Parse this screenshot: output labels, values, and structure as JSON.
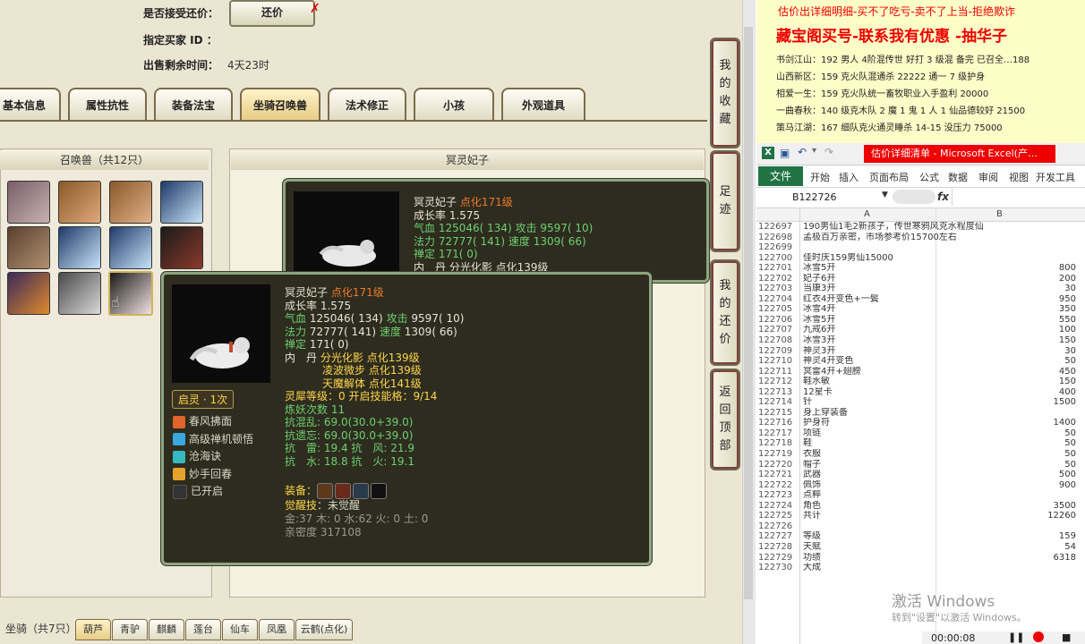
{
  "listing": {
    "accept_counter_label": "是否接受还价：",
    "counter_button": "还价",
    "buyer_label": "指定买家 ID ：",
    "time_left_label": "出售剩余时间：",
    "time_left_value": "4天23时"
  },
  "tabs": [
    "基本信息",
    "属性抗性",
    "装备法宝",
    "坐骑召唤兽",
    "法术修正",
    "小孩",
    "外观道具"
  ],
  "left_panel_title": "召唤兽（共12只）",
  "right_panel_title": "冥灵妃子",
  "side_buttons": [
    {
      "label": "我的收藏",
      "chars": [
        "我",
        "的",
        "收",
        "藏"
      ]
    },
    {
      "label": "足迹",
      "chars": [
        "足",
        "迹"
      ]
    },
    {
      "label": "我的还价",
      "chars": [
        "我",
        "的",
        "还",
        "价"
      ]
    },
    {
      "label": "返回顶部",
      "chars": [
        "返",
        "回",
        "顶",
        "部"
      ]
    }
  ],
  "tooltip_back": {
    "name": "冥灵妃子",
    "level": "点化171级",
    "growth": "成长率 1.575",
    "hp_line": "气血 125046( 134) 攻击 9597( 10)",
    "mp_line": "法力 72777( 141) 速度 1309( 66)",
    "zen_line": "禅定 171( 0)",
    "neidan_line": "内　丹 分光化影 点化139级"
  },
  "tooltip": {
    "name": "冥灵妃子",
    "level": "点化171级",
    "growth": "成长率 1.575",
    "hp_label": "气血",
    "hp_value": "125046( 134)",
    "atk_label": "攻击",
    "atk_value": "9597( 10)",
    "mp_label": "法力",
    "mp_value": "72777( 141)",
    "spd_label": "速度",
    "spd_value": "1309( 66)",
    "zen_label": "禅定",
    "zen_value": "171( 0)",
    "neidan_label": "内　丹",
    "neidan": [
      {
        "name": "分光化影",
        "level": "点化139级"
      },
      {
        "name": "凌波微步",
        "level": "点化139级"
      },
      {
        "name": "天魔解体",
        "level": "点化141级"
      }
    ],
    "qiling_badge": "启灵 · 1次",
    "skills": [
      {
        "name": "春风拂面",
        "icon": "fire-wind-icon",
        "color": "#e0632a"
      },
      {
        "name": "高级禅机顿悟",
        "icon": "zen-icon",
        "color": "#3aa8e0"
      },
      {
        "name": "沧海诀",
        "icon": "sea-icon",
        "color": "#38b8c0"
      },
      {
        "name": "妙手回春",
        "icon": "heal-icon",
        "color": "#e6a22a"
      },
      {
        "name": "已开启",
        "icon": "locked-icon",
        "color": "#333333"
      }
    ],
    "spirit_line": "灵犀等级：0 开启技能格：9/14",
    "refine_line": "炼妖次数 11",
    "resist_chaos": "抗混乱: 69.0(30.0+39.0)",
    "resist_forget": "抗遗忘: 69.0(30.0+39.0)",
    "resist_line1": "抗　雷: 19.4 抗　风: 21.9",
    "resist_line2": "抗　水: 18.8 抗　火: 19.1",
    "equip_label": "装备：",
    "awaken_label": "觉醒技",
    "awaken_value": "：未觉醒",
    "elements": "金:37 木: 0 水:62 火: 0 土: 0",
    "intimacy": "亲密度 317108"
  },
  "bottom_tabs": {
    "label": "坐骑（共7只）",
    "items": [
      "葫芦",
      "青驴",
      "麒麟",
      "莲台",
      "仙车",
      "凤凰",
      "云鹤(点化)"
    ]
  },
  "notes": {
    "banner": "估价出详细明细-买不了吃亏-卖不了上当-拒绝欺诈",
    "headline": "藏宝阁买号-联系我有优惠 -抽华子",
    "lines": [
      "书剑江山：192 男人 4阶混传世 好打 3 级混 备完 已召全…188",
      "山西新区：159 克火队混通杀 22222 通一 7 级护身",
      "相爱一生：159 克火队统一畜牧职业入手盈利 20000",
      "一曲春秋：140 级克木队 2 魔 1 鬼 1 人 1 仙品德较好 21500",
      "策马江湖：167 细队克火通灵睡杀 14-15 没压力 75000"
    ]
  },
  "excel": {
    "title": "估价详细清单 - Microsoft Excel(产…",
    "ribbon": [
      "文件",
      "开始",
      "插入",
      "页面布局",
      "公式",
      "数据",
      "审阅",
      "视图",
      "开发工具"
    ],
    "name_box": "B122726",
    "fx": "fx",
    "col_a": "A",
    "col_b": "B",
    "rows": [
      [
        "122697",
        "190男仙1毛2新孩子，传世寒鸦风克水程度仙",
        ""
      ],
      [
        "122698",
        "孟极百万亲密，市场参考价15700左右",
        ""
      ],
      [
        "122699",
        "",
        ""
      ],
      [
        "122700",
        "佳时庆159男仙15000",
        ""
      ],
      [
        "122701",
        "冰雪5开",
        "800"
      ],
      [
        "122702",
        "妃子6开",
        "200"
      ],
      [
        "122703",
        "当康3开",
        "30"
      ],
      [
        "122704",
        "红衣4开变色+一鬓",
        "950"
      ],
      [
        "122705",
        "冰雪4开",
        "350"
      ],
      [
        "122706",
        "冰雪5开",
        "550"
      ],
      [
        "122707",
        "九戒6开",
        "100"
      ],
      [
        "122708",
        "冰雪3开",
        "150"
      ],
      [
        "122709",
        "神灵3开",
        "30"
      ],
      [
        "122710",
        "神灵4开变色",
        "50"
      ],
      [
        "122711",
        "冥雷4开+翅膀",
        "450"
      ],
      [
        "122712",
        "鞋水敏",
        "150"
      ],
      [
        "122713",
        "12星卡",
        "400"
      ],
      [
        "122714",
        "针",
        "1500"
      ],
      [
        "122715",
        "身上穿装备",
        ""
      ],
      [
        "122716",
        "护身符",
        "1400"
      ],
      [
        "122717",
        "项链",
        "50"
      ],
      [
        "122718",
        "鞋",
        "50"
      ],
      [
        "122719",
        "衣服",
        "50"
      ],
      [
        "122720",
        "帽子",
        "50"
      ],
      [
        "122721",
        "武器",
        "500"
      ],
      [
        "122722",
        "佩饰",
        "900"
      ],
      [
        "122723",
        "点粹",
        ""
      ],
      [
        "122724",
        "角色",
        "3500"
      ],
      [
        "122725",
        "共计",
        "12260"
      ],
      [
        "122726",
        "",
        ""
      ],
      [
        "122727",
        "等级",
        "159"
      ],
      [
        "122728",
        "天赋",
        "54"
      ],
      [
        "122729",
        "功绩",
        "6318"
      ],
      [
        "122730",
        "大成",
        ""
      ]
    ]
  },
  "watermark": {
    "line1": "激活 Windows",
    "line2": "转到\"设置\"以激活 Windows。"
  },
  "video_time": "00:00:08",
  "colors": {
    "accent_red": "#e00000",
    "excel_green": "#217346",
    "tooltip_bg": "#2d2c1f"
  }
}
